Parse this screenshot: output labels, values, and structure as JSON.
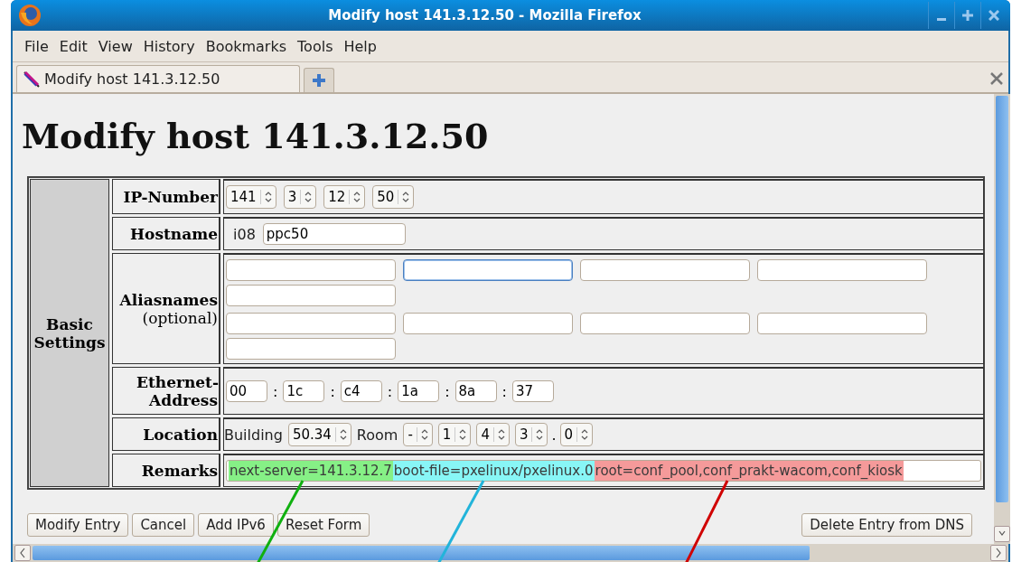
{
  "window": {
    "title": "Modify host 141.3.12.50 - Mozilla Firefox"
  },
  "menu": [
    {
      "label": "File"
    },
    {
      "label": "Edit"
    },
    {
      "label": "View"
    },
    {
      "label": "History"
    },
    {
      "label": "Bookmarks"
    },
    {
      "label": "Tools"
    },
    {
      "label": "Help"
    }
  ],
  "tabs": [
    {
      "label": "Modify host 141.3.12.50",
      "selected": true
    }
  ],
  "heading": "Modify host 141.3.12.50",
  "form": {
    "section": "Basic Settings",
    "rows": [
      {
        "kind": "ip",
        "label": "IP-Number",
        "spinners": [
          {
            "value": "141"
          },
          {
            "value": "3"
          },
          {
            "value": "12"
          },
          {
            "value": "50"
          }
        ]
      },
      {
        "kind": "hostname",
        "label": "Hostname",
        "prefix": "i08",
        "value": "ppc50"
      },
      {
        "kind": "aliases",
        "label": "Aliasnames",
        "hint": "(optional)",
        "groups": [
          [
            {
              "focused": false
            },
            {
              "focused": true
            },
            {
              "focused": false
            },
            {
              "focused": false
            },
            {
              "focused": false
            }
          ],
          [
            {
              "focused": false
            },
            {
              "focused": false
            },
            {
              "focused": false
            },
            {
              "focused": false
            },
            {
              "focused": false
            }
          ]
        ]
      },
      {
        "kind": "ethernet",
        "label": "Ethernet-Address",
        "separator": ":",
        "fields": [
          {
            "value": "00"
          },
          {
            "value": "1c"
          },
          {
            "value": "c4"
          },
          {
            "value": "1a"
          },
          {
            "value": "8a"
          },
          {
            "value": "37"
          }
        ]
      },
      {
        "kind": "location",
        "label": "Location",
        "building_label": "Building",
        "building": {
          "value": "50.34"
        },
        "room_label": "Room",
        "rooms": [
          {
            "value": "-"
          },
          {
            "value": "1"
          },
          {
            "value": "4"
          },
          {
            "value": "3"
          }
        ],
        "dot": ".",
        "room_suffix": {
          "value": "0"
        }
      },
      {
        "kind": "remarks",
        "label": "Remarks",
        "segments": [
          {
            "text": "next-server=141.3.12.7",
            "color": "#86f086",
            "leader": {
              "color": "#10b010"
            }
          },
          {
            "text": "boot-file=pxelinux/pxelinux.0",
            "color": "#88f6f6",
            "leader": {
              "color": "#22b4da"
            }
          },
          {
            "text": "root=conf_pool,conf_prakt-wacom,conf_kiosk",
            "color": "#f59a9a",
            "leader": {
              "color": "#d00000"
            }
          }
        ]
      }
    ]
  },
  "buttons": [
    {
      "label": "Modify Entry"
    },
    {
      "label": "Cancel"
    },
    {
      "label": "Add IPv6"
    },
    {
      "label": "Reset Form"
    }
  ],
  "right_button": {
    "label": "Delete Entry from DNS"
  }
}
